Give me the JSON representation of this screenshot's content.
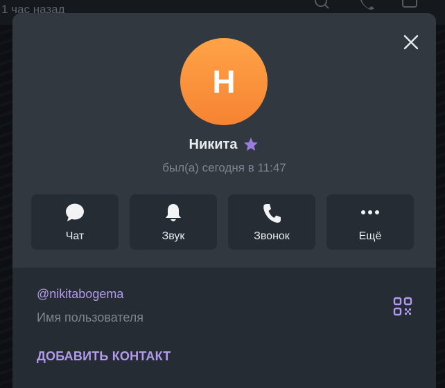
{
  "background": {
    "status_text": "1 час назад"
  },
  "profile": {
    "avatar_letter": "Н",
    "name": "Никита",
    "last_seen": "был(а) сегодня в 11:47"
  },
  "actions": [
    {
      "label": "Чат",
      "icon": "chat-bubble-icon"
    },
    {
      "label": "Звук",
      "icon": "bell-icon"
    },
    {
      "label": "Звонок",
      "icon": "phone-icon"
    },
    {
      "label": "Ещё",
      "icon": "more-dots-icon"
    }
  ],
  "info": {
    "username": "@nikitabogema",
    "username_caption": "Имя пользователя",
    "add_contact": "ДОБАВИТЬ КОНТАКТ"
  },
  "colors": {
    "modal_bg": "#313840",
    "card_bg": "#262c33",
    "accent": "#b39bec",
    "avatar_top": "#ffa348",
    "avatar_bottom": "#f68332"
  }
}
